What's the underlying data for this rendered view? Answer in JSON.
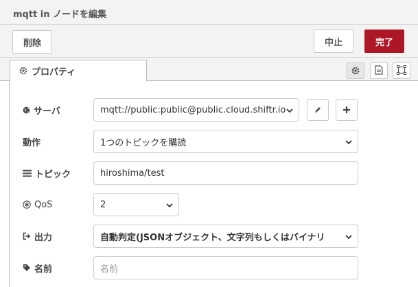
{
  "window": {
    "title": "mqtt in ノードを編集"
  },
  "toolbar": {
    "delete_label": "削除",
    "cancel_label": "中止",
    "done_label": "完了"
  },
  "tabs": {
    "properties_label": "プロパティ"
  },
  "form": {
    "server": {
      "label": "サーバ",
      "value": "mqtt://public:public@public.cloud.shiftr.io"
    },
    "action": {
      "label": "動作",
      "value": "1つのトピックを購読"
    },
    "topic": {
      "label": "トピック",
      "value": "hiroshima/test"
    },
    "qos": {
      "label": "QoS",
      "value": "2"
    },
    "output": {
      "label": "出力",
      "value": "自動判定(JSONオブジェクト、文字列もしくはバイナリ"
    },
    "name": {
      "label": "名前",
      "value": "",
      "placeholder": "名前"
    }
  },
  "icons": {
    "gear": "gear-icon",
    "globe": "globe-icon",
    "pencil": "pencil-icon",
    "plus": "plus-icon",
    "list": "list-icon",
    "qos": "asterisk-circle-icon",
    "output": "sign-out-icon",
    "tag": "tag-icon",
    "description": "file-icon",
    "appearance": "frame-icon"
  },
  "colors": {
    "accent": "#ad1625",
    "panel_bg": "#f3f3f3",
    "border": "#cccccc"
  }
}
